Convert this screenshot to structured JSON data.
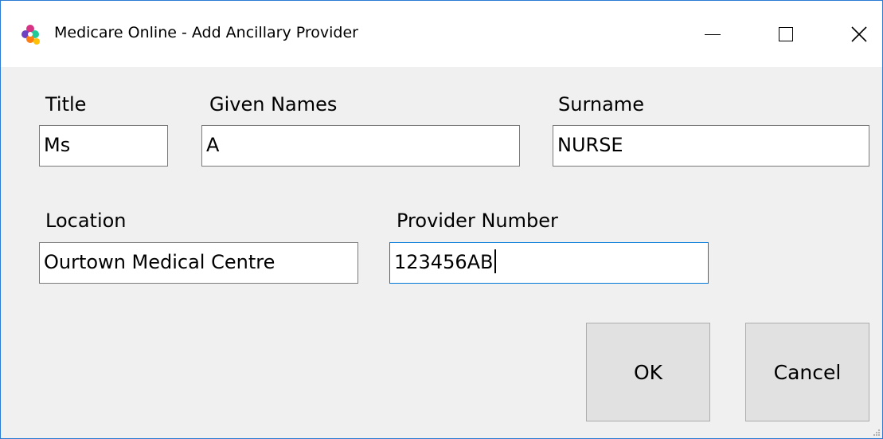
{
  "window": {
    "title": "Medicare Online - Add Ancillary Provider",
    "controls": {
      "minimize": "minimize",
      "maximize": "maximize",
      "close": "close"
    }
  },
  "form": {
    "title": {
      "label": "Title",
      "value": "Ms"
    },
    "given_names": {
      "label": "Given Names",
      "value": "A"
    },
    "surname": {
      "label": "Surname",
      "value": "NURSE"
    },
    "location": {
      "label": "Location",
      "value": "Ourtown Medical Centre"
    },
    "provider_number": {
      "label": "Provider Number",
      "value": "123456AB"
    }
  },
  "buttons": {
    "ok": "OK",
    "cancel": "Cancel"
  },
  "icons": {
    "app": "medicare-app-icon",
    "minimize": "minimize-icon",
    "maximize": "maximize-icon",
    "close": "close-icon"
  },
  "colors": {
    "accent": "#0078d7",
    "window_border": "#2b7bd4",
    "background": "#f0f0f0"
  }
}
